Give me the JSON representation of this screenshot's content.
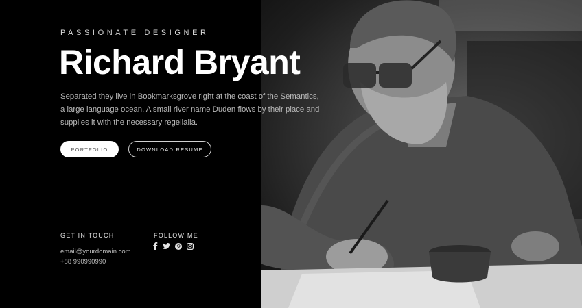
{
  "hero": {
    "subtitle": "PASSIONATE DESIGNER",
    "name": "Richard Bryant",
    "bio": "Separated they live in Bookmarksgrove right at the coast of the Semantics, a large language ocean. A small river name Duden flows by their place and supplies it with the necessary regelialia."
  },
  "buttons": {
    "portfolio": "Portfolio",
    "download": "Download Resume"
  },
  "contact": {
    "title": "Get in Touch",
    "email": "email@yourdomain.com",
    "phone": "+88 990990990"
  },
  "follow": {
    "title": "Follow Me",
    "icons": [
      "facebook-icon",
      "twitter-icon",
      "pinterest-icon",
      "instagram-icon"
    ]
  },
  "colors": {
    "background": "#000000",
    "text": "#ffffff"
  }
}
